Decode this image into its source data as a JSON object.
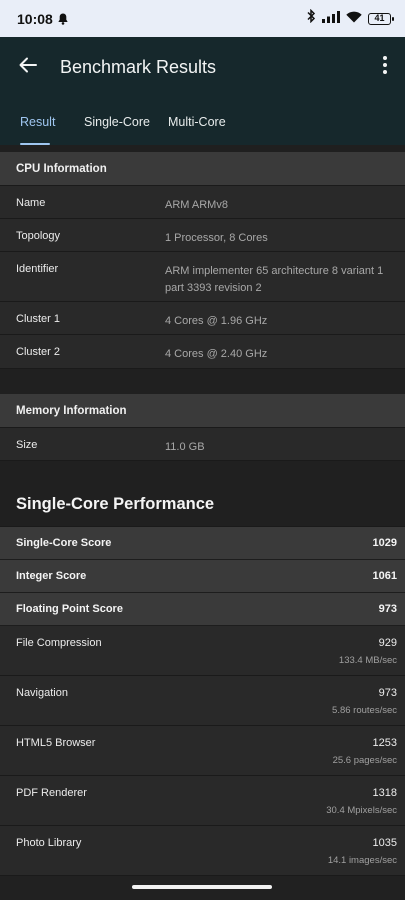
{
  "status_bar": {
    "time": "10:08",
    "battery": "41"
  },
  "app_bar": {
    "title": "Benchmark Results"
  },
  "tabs": [
    {
      "label": "Result"
    },
    {
      "label": "Single-Core"
    },
    {
      "label": "Multi-Core"
    }
  ],
  "cpu": {
    "header": "CPU Information",
    "rows": [
      {
        "label": "Name",
        "value": "ARM ARMv8"
      },
      {
        "label": "Topology",
        "value": "1 Processor, 8 Cores"
      },
      {
        "label": "Identifier",
        "value": "ARM implementer 65 architecture 8 variant 1 part 3393 revision 2"
      },
      {
        "label": "Cluster 1",
        "value": "4 Cores @ 1.96 GHz"
      },
      {
        "label": "Cluster 2",
        "value": "4 Cores @ 2.40 GHz"
      }
    ]
  },
  "memory": {
    "header": "Memory Information",
    "rows": [
      {
        "label": "Size",
        "value": "11.0 GB"
      }
    ]
  },
  "single_core": {
    "title": "Single-Core Performance",
    "scores": [
      {
        "label": "Single-Core Score",
        "value": "1029"
      },
      {
        "label": "Integer Score",
        "value": "1061"
      },
      {
        "label": "Floating Point Score",
        "value": "973"
      }
    ],
    "benchmarks": [
      {
        "name": "File Compression",
        "score": "929",
        "metric": "133.4 MB/sec"
      },
      {
        "name": "Navigation",
        "score": "973",
        "metric": "5.86 routes/sec"
      },
      {
        "name": "HTML5 Browser",
        "score": "1253",
        "metric": "25.6 pages/sec"
      },
      {
        "name": "PDF Renderer",
        "score": "1318",
        "metric": "30.4 Mpixels/sec"
      },
      {
        "name": "Photo Library",
        "score": "1035",
        "metric": "14.1 images/sec"
      }
    ]
  },
  "icons": {
    "back": "arrow-left-icon",
    "more": "more-vertical-icon",
    "notification": "bell-icon",
    "bluetooth": "bluetooth-icon",
    "signal": "signal-icon",
    "wifi": "wifi-icon",
    "battery": "battery-icon"
  },
  "colors": {
    "app_bar": "#16282c",
    "status_bar": "#e9eef8",
    "active_tab": "#9fc6f0",
    "background": "#212121",
    "section_header": "#3a3a3a",
    "row": "#292929"
  }
}
